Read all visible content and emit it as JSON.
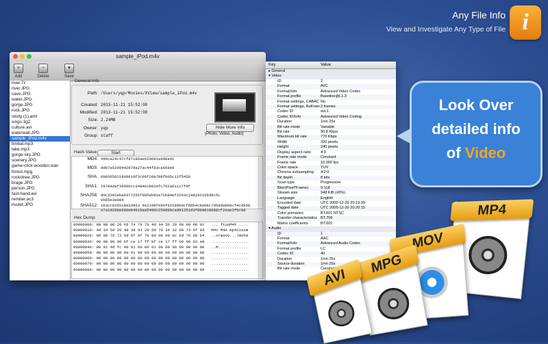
{
  "promo": {
    "app_name": "Any File Info",
    "tagline": "View and Investigate Any Type of File",
    "bubble_line1": "Look Over",
    "bubble_line2": "detailed info",
    "bubble_line3_prefix": "of",
    "bubble_line3_accent": "Video",
    "colors": {
      "accent": "#f8a51e",
      "bubble": "#3a82d8",
      "background": "#2d4f93"
    },
    "file_badges": [
      "MP4",
      "MOV",
      "MPG",
      "AVI"
    ]
  },
  "window": {
    "title": "sample_iPod.m4v",
    "toolbar": {
      "add": "Add",
      "delete": "Delete",
      "save": "Save"
    }
  },
  "files": [
    "river.7z",
    "river.JPG",
    "cave.JPG",
    "water.JPG",
    "gorge.JPG",
    "rock.JPG",
    "study (1).amr",
    "sings.3g2",
    "culture.avi",
    "waterwall.JPG",
    "sample_iPod.m4v",
    "timbal.mp3",
    "lake.mp3",
    "gorge-sky.JPG",
    "scenery.JPG",
    "game-click-wooden.wav",
    "forest.mpg",
    "rockotree.JPG",
    "brage.JPG",
    "person.JPG",
    "fast-hand.avi",
    "rember.ac3",
    "rivulet.JPG"
  ],
  "selected_file": "sample_iPod.m4v",
  "general_info": {
    "label": "General Info",
    "rows": [
      {
        "k": "Path:",
        "v": "/Users/yqp/Movies/XView/sample_iPod.m4v"
      },
      {
        "k": "Created:",
        "v": "2013-11-21 15:52:00"
      },
      {
        "k": "Modified:",
        "v": "2013-11-21 15:52:08"
      },
      {
        "k": "Size:",
        "v": "2.24MB"
      },
      {
        "k": "Owner:",
        "v": "yqp"
      },
      {
        "k": "Group:",
        "v": "staff"
      }
    ],
    "hide_button": "Hide More Info",
    "caption": "(Photo, Video, Audio)"
  },
  "hash": {
    "label": "Hash Value",
    "start_button": "Start",
    "rows": [
      {
        "k": "MD4:",
        "v": "496ca24c47cf87186ae620691a4d0a41"
      },
      {
        "k": "MD5:",
        "v": "ddb7a52094d2079a27ac44f83ca669e9"
      },
      {
        "k": "SHA:",
        "v": "0b8365621968019f2c09f2da788fb05c12f5459"
      },
      {
        "k": "SHA1:",
        "v": "19784daf34586cc348481b92efc762a61117fdf"
      },
      {
        "k": "SHA256:",
        "v": "d0c3302eba6377255f985ebd1e7cb94ef2293c14d192156d9c5c",
        "v2": "eb65e3a984"
      },
      {
        "k": "SHA512:",
        "v": "1b3cc935518833963 4e2199fe96f62296b9cfd6b4c8a6bc7d58da8b8cf4cd858",
        "v2": "e7a1d28be689eb4616ae5490c250d6bcad91251d3f8b9d10088cf2eae3f5c0d"
      }
    ]
  },
  "hex": {
    "label": "Hex Dump",
    "lines": [
      "00000000: 00 00 00 20 66 74 79 70 4d 34 56 20 00 00 00 01   ... ftypM4V ....",
      "00000010: 4d 34 56 20 4d 34 41 20 6d 70 34 32 69 73 6f 6d   M4V M4A mp42isom",
      "00000020: 00 00 76 72 6d 6f 6f 76 00 00 00 6c 6d 76 68 64   ..vrmoov...lmvhd",
      "00000030: 00 00 00 00 bf ce 17 ff bf ce 17 ff 00 00 03 e8   ................",
      "00000040: 00 01 4d fc 00 01 00 00 01 00 00 00 00 00 00 00   ..M.............",
      "00000050: 00 00 00 00 00 01 00 00 00 00 00 00 00 00 00 00   ................",
      "00000060: 00 00 00 00 00 00 00 00 00 00 00 00 00 00 00 00   ................",
      "00000070: 00 00 00 00 00 00 00 00 00 00 00 00 00 00 00 00   ................",
      "00000080: 00 00 00 00 00 00 00 00 00 00 00 00 00 00 00 00   ................"
    ]
  },
  "details": {
    "col_key": "Key",
    "col_value": "Value",
    "rows": [
      {
        "sec": true,
        "k": "▸ General",
        "v": ""
      },
      {
        "sec": true,
        "k": "▾ Video",
        "v": ""
      },
      {
        "k": "ID",
        "v": "2"
      },
      {
        "k": "Format",
        "v": "AVC"
      },
      {
        "k": "Format/Info",
        "v": "Advanced Video Codec"
      },
      {
        "k": "Format profile",
        "v": "Baseline@L1.3"
      },
      {
        "k": "Format settings, CABAC",
        "v": "No"
      },
      {
        "k": "Format settings, ReFram",
        "v": "2 frames"
      },
      {
        "k": "Codec ID",
        "v": "avc1"
      },
      {
        "k": "Codec ID/Info",
        "v": "Advanced Video Coding"
      },
      {
        "k": "Duration",
        "v": "1mn 25s"
      },
      {
        "k": "Bit rate mode",
        "v": "Variable"
      },
      {
        "k": "Bit rate",
        "v": "90.8 Kbps"
      },
      {
        "k": "Maximum bit rate",
        "v": "770 Kbps"
      },
      {
        "k": "Width",
        "v": "320 pixels"
      },
      {
        "k": "Height",
        "v": "240 pixels"
      },
      {
        "k": "Display aspect ratio",
        "v": "4:3"
      },
      {
        "k": "Frame rate mode",
        "v": "Constant"
      },
      {
        "k": "Frame rate",
        "v": "10.000 fps"
      },
      {
        "k": "Color space",
        "v": "YUV"
      },
      {
        "k": "Chroma subsampling",
        "v": "4:2:0"
      },
      {
        "k": "Bit depth",
        "v": "8 bits"
      },
      {
        "k": "Scan type",
        "v": "Progressive"
      },
      {
        "k": "Bits/(Pixel*Frame)",
        "v": "0.118"
      },
      {
        "k": "Stream size",
        "v": "948 KiB (43%)"
      },
      {
        "k": "Language",
        "v": "English"
      },
      {
        "k": "Encoded date",
        "v": "UTC 2005-12-20 20:19:39"
      },
      {
        "k": "Tagged date",
        "v": "UTC 2005-12-20 20:20:15"
      },
      {
        "k": "Color primaries",
        "v": "BT.601 NTSC"
      },
      {
        "k": "Transfer characteristics",
        "v": "BT.709"
      },
      {
        "k": "Matrix coefficients",
        "v": "BT.601"
      },
      {
        "sec": true,
        "k": "▾ Audio",
        "v": ""
      },
      {
        "k": "ID",
        "v": "1"
      },
      {
        "k": "Format",
        "v": "AAC"
      },
      {
        "k": "Format/Info",
        "v": "Advanced Audio Codec"
      },
      {
        "k": "Format profile",
        "v": "LC"
      },
      {
        "k": "Codec ID",
        "v": "40"
      },
      {
        "k": "Duration",
        "v": "1mn 25s"
      },
      {
        "k": "Source duration",
        "v": "1mn 25s"
      },
      {
        "k": "Bit rate mode",
        "v": "Constant"
      }
    ]
  }
}
